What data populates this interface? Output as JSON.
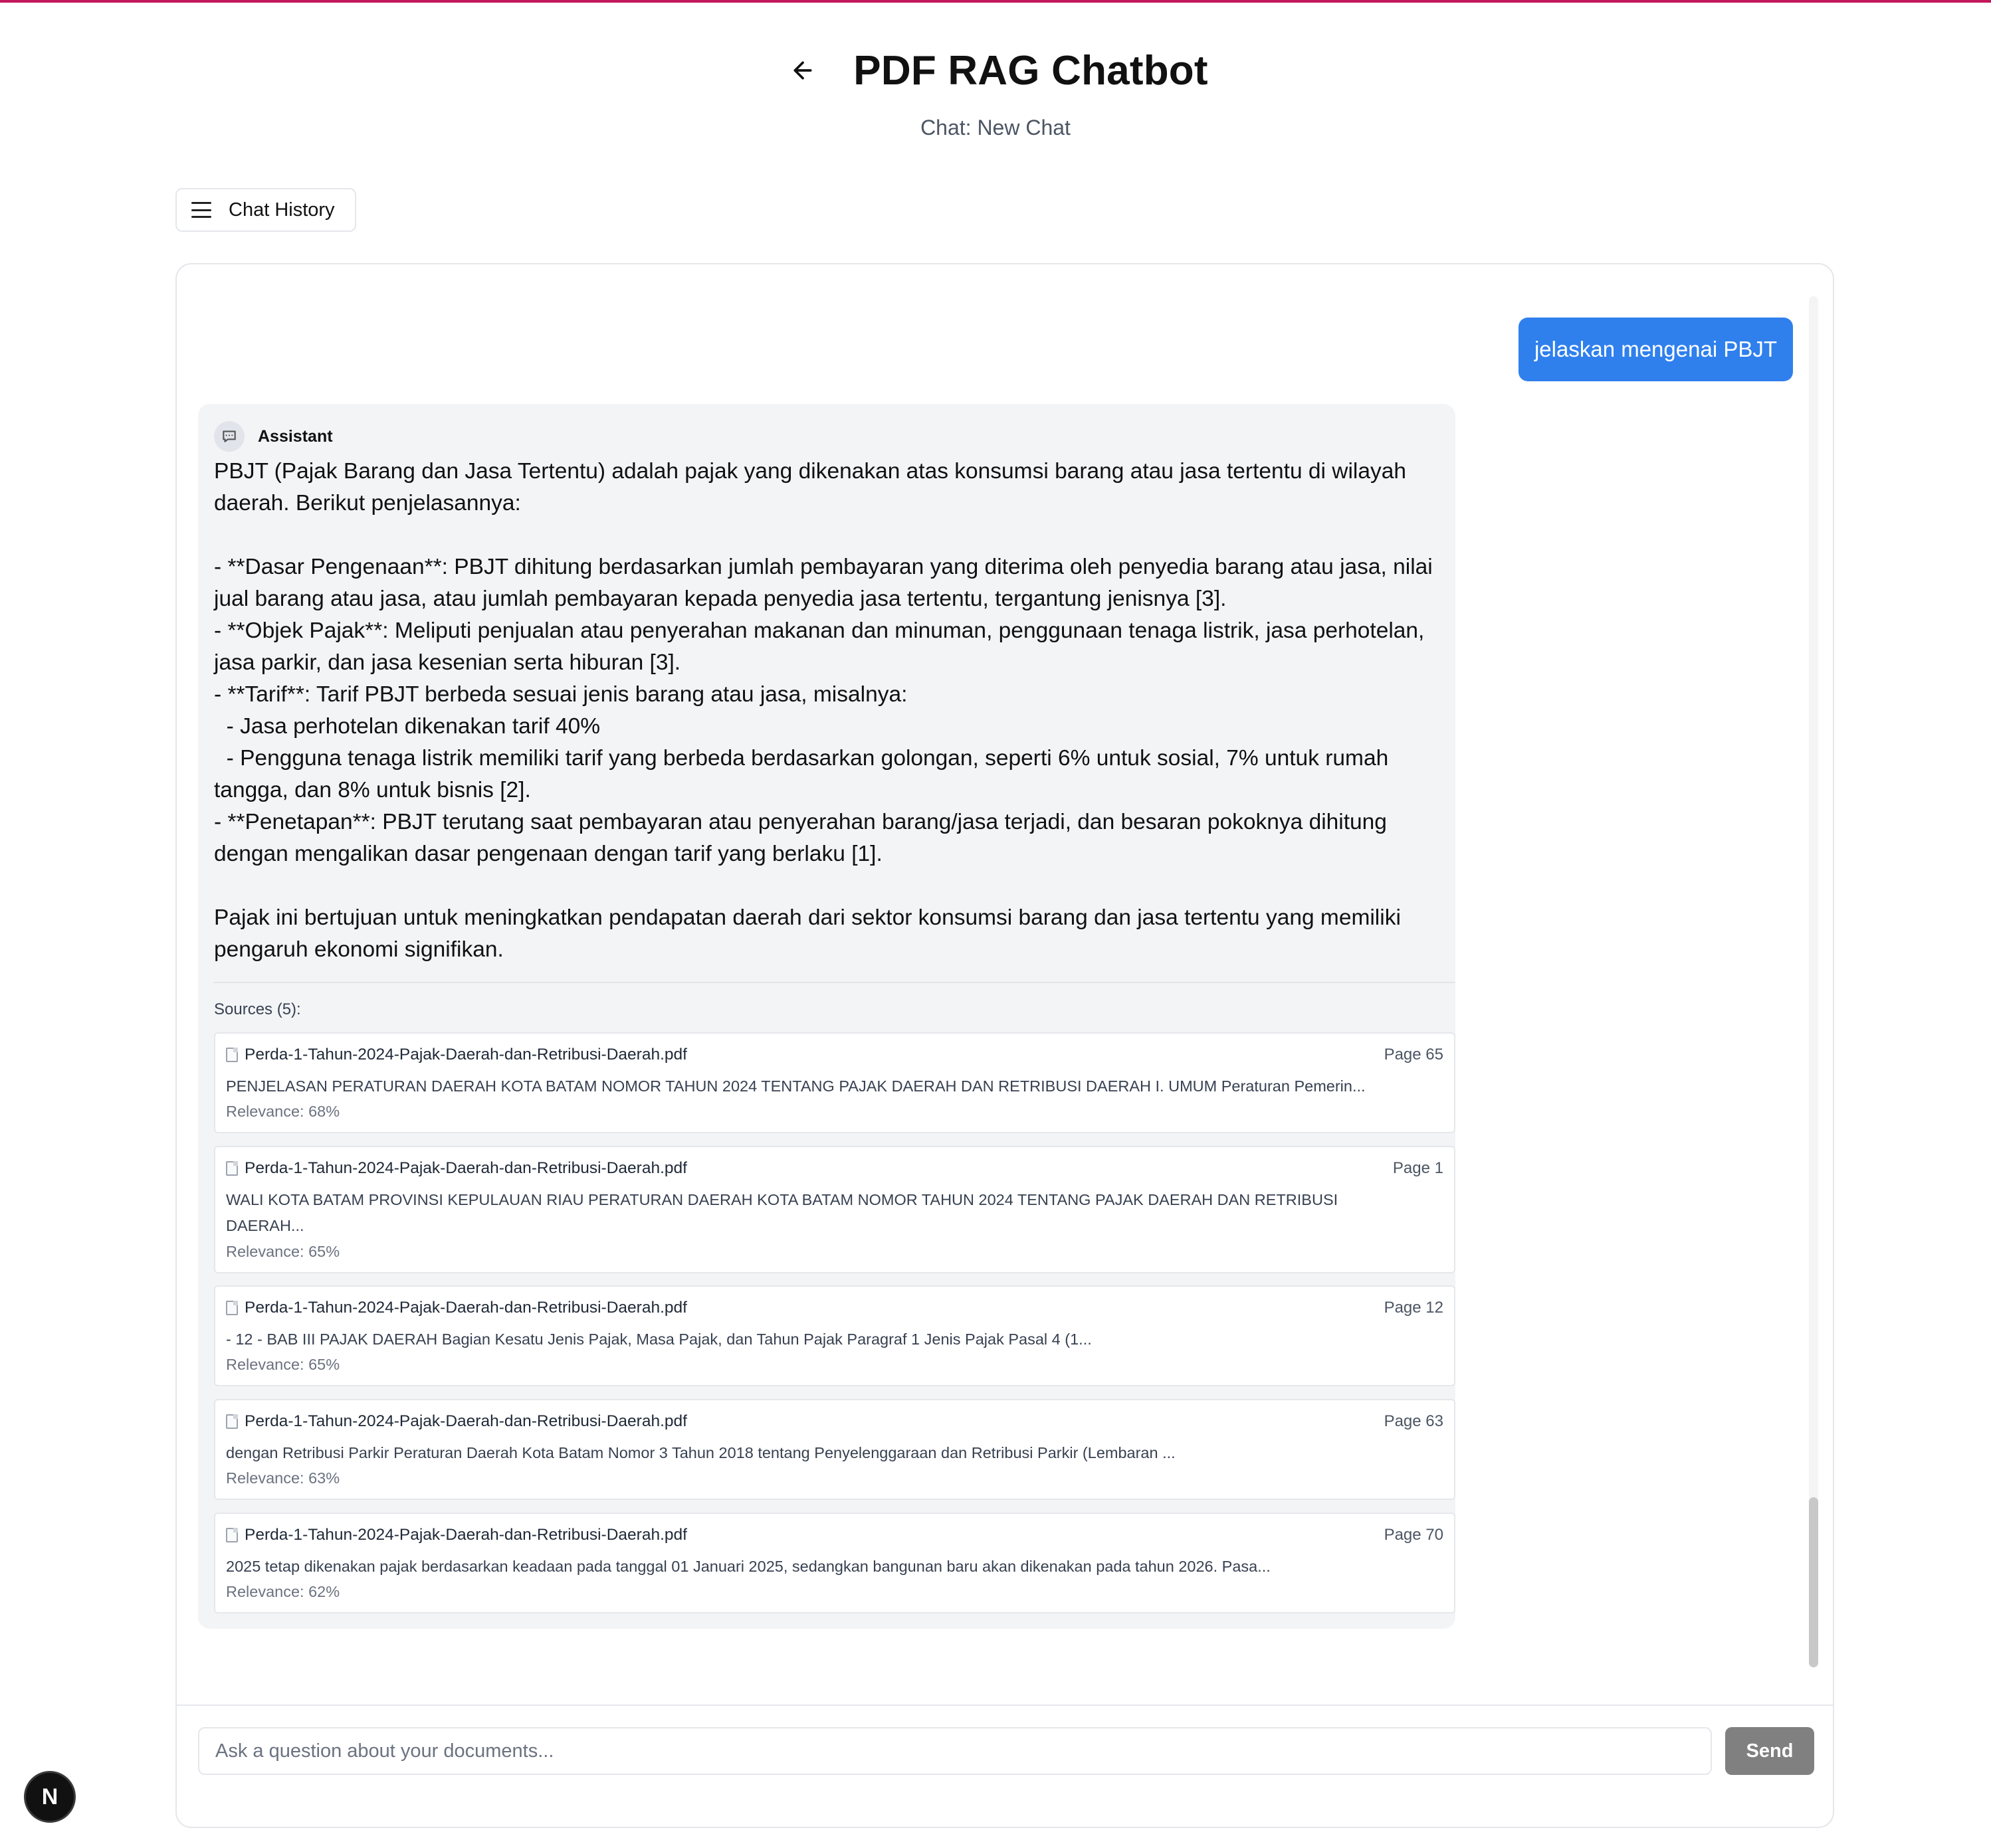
{
  "colors": {
    "accent": "#c2185b",
    "user_bubble": "#2f80ed",
    "send_button": "#808080",
    "assistant_bg": "#f3f4f6"
  },
  "header": {
    "title": "PDF RAG Chatbot",
    "subtitle": "Chat: New Chat",
    "back_icon": "arrow-left-icon"
  },
  "history_button": {
    "label": "Chat History",
    "icon": "menu-icon"
  },
  "messages": {
    "user": "jelaskan mengenai PBJT",
    "assistant": {
      "label": "Assistant",
      "icon": "chat-bubble-icon",
      "paragraphs": [
        "PBJT (Pajak Barang dan Jasa Tertentu) adalah pajak yang dikenakan atas konsumsi barang atau jasa tertentu di wilayah daerah. Berikut penjelasannya:",
        "",
        "- **Dasar Pengenaan**: PBJT dihitung berdasarkan jumlah pembayaran yang diterima oleh penyedia barang atau jasa, nilai jual barang atau jasa, atau jumlah pembayaran kepada penyedia jasa tertentu, tergantung jenisnya [3].",
        "- **Objek Pajak**: Meliputi penjualan atau penyerahan makanan dan minuman, penggunaan tenaga listrik, jasa perhotelan, jasa parkir, dan jasa kesenian serta hiburan [3].",
        "- **Tarif**: Tarif PBJT berbeda sesuai jenis barang atau jasa, misalnya:",
        "  - Jasa perhotelan dikenakan tarif 40%",
        "  - Pengguna tenaga listrik memiliki tarif yang berbeda berdasarkan golongan, seperti 6% untuk sosial, 7% untuk rumah tangga, dan 8% untuk bisnis [2].",
        "- **Penetapan**: PBJT terutang saat pembayaran atau penyerahan barang/jasa terjadi, dan besaran pokoknya dihitung dengan mengalikan dasar pengenaan dengan tarif yang berlaku [1].",
        "",
        "Pajak ini bertujuan untuk meningkatkan pendapatan daerah dari sektor konsumsi barang dan jasa tertentu yang memiliki pengaruh ekonomi signifikan."
      ],
      "sources_title": "Sources (5):",
      "sources": [
        {
          "file": "Perda-1-Tahun-2024-Pajak-Daerah-dan-Retribusi-Daerah.pdf",
          "page": "Page 65",
          "excerpt": "PENJELASAN PERATURAN DAERAH KOTA BATAM NOMOR TAHUN 2024 TENTANG PAJAK DAERAH DAN RETRIBUSI DAERAH I. UMUM Peraturan Pemerin...",
          "relevance": "Relevance: 68%"
        },
        {
          "file": "Perda-1-Tahun-2024-Pajak-Daerah-dan-Retribusi-Daerah.pdf",
          "page": "Page 1",
          "excerpt": "WALI KOTA BATAM PROVINSI KEPULAUAN RIAU PERATURAN DAERAH KOTA BATAM NOMOR TAHUN 2024 TENTANG PAJAK DAERAH DAN RETRIBUSI DAERAH...",
          "relevance": "Relevance: 65%"
        },
        {
          "file": "Perda-1-Tahun-2024-Pajak-Daerah-dan-Retribusi-Daerah.pdf",
          "page": "Page 12",
          "excerpt": "- 12 - BAB III PAJAK DAERAH Bagian Kesatu Jenis Pajak, Masa Pajak, dan Tahun Pajak Paragraf 1 Jenis Pajak Pasal 4 (1...",
          "relevance": "Relevance: 65%"
        },
        {
          "file": "Perda-1-Tahun-2024-Pajak-Daerah-dan-Retribusi-Daerah.pdf",
          "page": "Page 63",
          "excerpt": "dengan Retribusi Parkir Peraturan Daerah Kota Batam Nomor 3 Tahun 2018 tentang Penyelenggaraan dan Retribusi Parkir (Lembaran ...",
          "relevance": "Relevance: 63%"
        },
        {
          "file": "Perda-1-Tahun-2024-Pajak-Daerah-dan-Retribusi-Daerah.pdf",
          "page": "Page 70",
          "excerpt": "2025 tetap dikenakan pajak berdasarkan keadaan pada tanggal 01 Januari 2025, sedangkan bangunan baru akan dikenakan pada tahun 2026. Pasa...",
          "relevance": "Relevance: 62%"
        }
      ]
    }
  },
  "input": {
    "placeholder": "Ask a question about your documents...",
    "value": "",
    "send_label": "Send"
  },
  "dev_badge": {
    "letter": "N"
  }
}
